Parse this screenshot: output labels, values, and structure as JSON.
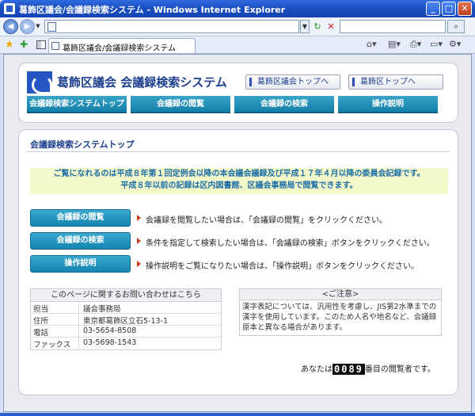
{
  "window": {
    "title": "葛飾区議会/会議録検索システム - Windows Internet Explorer",
    "minimize": "_",
    "maximize": "□",
    "close": "✕"
  },
  "browser": {
    "address_value": "",
    "search_value": "",
    "tab_label": "葛飾区議会/会議録検索システム"
  },
  "header": {
    "site_title": "葛飾区議会  会議録検索システム",
    "links": [
      {
        "label": "葛飾区議会トップへ"
      },
      {
        "label": "葛飾区トップへ"
      }
    ],
    "nav": [
      {
        "label": "会議録検索システムトップ"
      },
      {
        "label": "会議録の閲覧"
      },
      {
        "label": "会議録の検索"
      },
      {
        "label": "操作説明"
      }
    ]
  },
  "main": {
    "section_title": "会議録検索システムトップ",
    "notice_lines": [
      "ご覧になれるのは平成８年第１回定例会以降の本会議会議録及び平成１７年４月以降の委員会記録です。",
      "平成８年以前の記録は区内図書館、区議会事務局で閲覧できます。"
    ],
    "actions": [
      {
        "label": "会議録の閲覧",
        "desc": "会議録を閲覧したい場合は、「会議録の閲覧」をクリックください。"
      },
      {
        "label": "会議録の検索",
        "desc": "条件を指定して検索したい場合は、「会議録の検索」ボタンをクリックください。"
      },
      {
        "label": "操作説明",
        "desc": "操作説明をご覧になりたい場合は、「操作説明」ボタンをクリックください。"
      }
    ],
    "contact": {
      "heading": "このページに関するお問い合わせはこちら",
      "rows": [
        {
          "key": "担当",
          "value": "議会事務局"
        },
        {
          "key": "住所",
          "value": "東京都葛飾区立石5-13-1"
        },
        {
          "key": "電話",
          "value": "03-5654-8508"
        },
        {
          "key": "ファックス",
          "value": "03-5698-1543"
        }
      ]
    },
    "caution": {
      "heading": "<ご注意>",
      "body": "漢字表記については、汎用性を考慮し、JIS第2水準までの漢字を使用しています。このため人名や地名など、会議録原本と異なる場合があります。"
    },
    "counter": {
      "prefix": "あなたは",
      "digits": "0089",
      "suffix": "番目の閲覧者です。"
    }
  }
}
